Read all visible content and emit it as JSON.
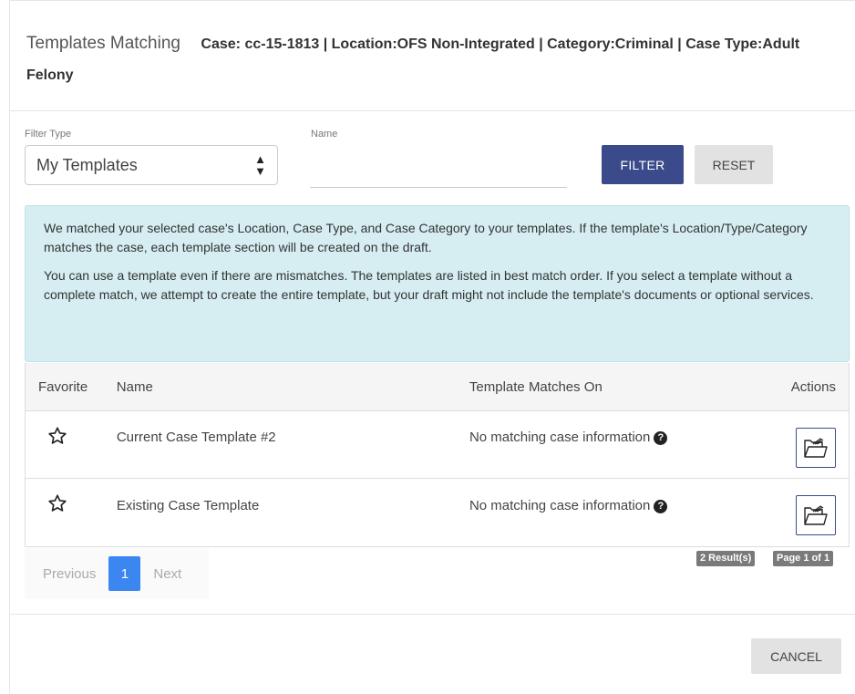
{
  "header": {
    "title": "Templates Matching",
    "case_info": "Case: cc-15-1813 | Location:OFS Non-Integrated | Category:Criminal | Case Type:Adult Felony"
  },
  "filters": {
    "filter_type_label": "Filter Type",
    "filter_type_value": "My Templates",
    "name_label": "Name",
    "name_value": "",
    "filter_button": "FILTER",
    "reset_button": "RESET"
  },
  "info": {
    "paragraph1": "We matched your selected case's Location, Case Type, and Case Category to your templates. If the template's Location/Type/Category matches the case, each template section will be created on the draft.",
    "paragraph2": "You can use a template even if there are mismatches. The templates are listed in best match order. If you select a template without a complete match, we attempt to create the entire template, but your draft might not include the template's documents or optional services."
  },
  "table": {
    "columns": {
      "favorite": "Favorite",
      "name": "Name",
      "matches": "Template Matches On",
      "actions": "Actions"
    },
    "rows": [
      {
        "name": "Current Case Template #2",
        "matches": "No matching case information"
      },
      {
        "name": "Existing Case Template",
        "matches": "No matching case information"
      }
    ]
  },
  "pagination": {
    "previous": "Previous",
    "current_page": "1",
    "next": "Next",
    "results_badge": "2 Result(s)",
    "page_badge": "Page 1 of 1"
  },
  "footer": {
    "cancel_button": "CANCEL"
  },
  "colors": {
    "primary": "#3a4a8a",
    "info_bg": "#d6eef2",
    "page_active": "#3b86f0",
    "badge": "#7a7a7a"
  },
  "icons": {
    "favorite": "star-outline-icon",
    "help": "question-circle-icon",
    "open": "open-folder-icon"
  }
}
